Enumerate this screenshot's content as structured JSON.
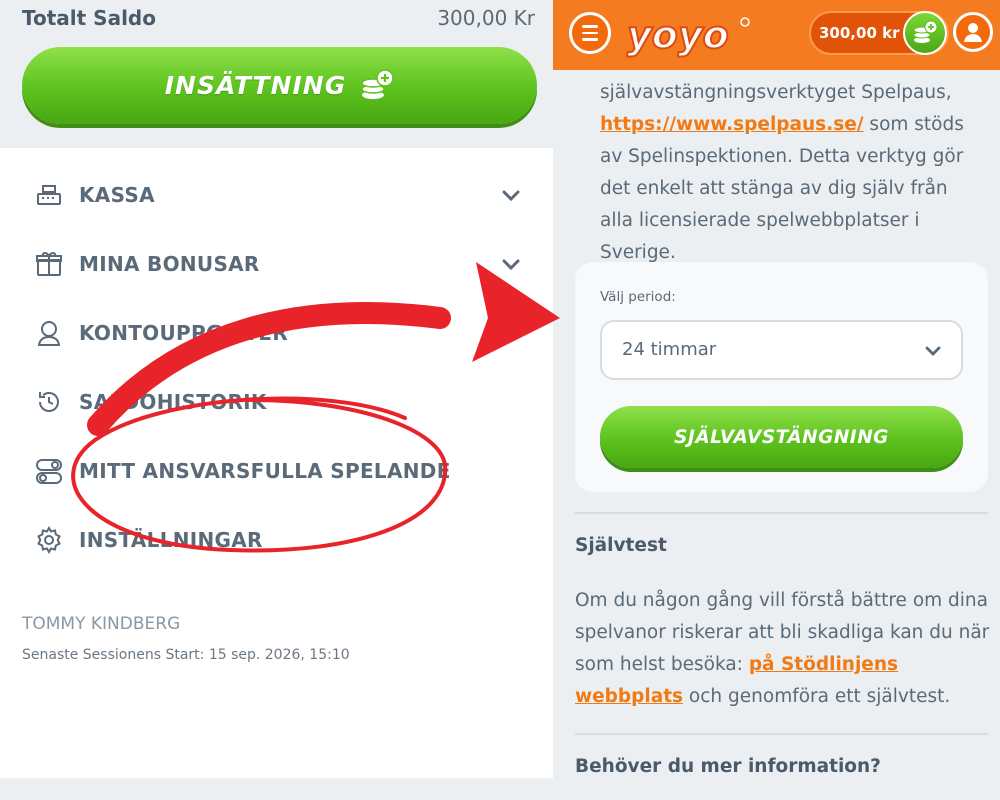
{
  "left": {
    "saldo_label": "Totalt Saldo",
    "saldo_value": "300,00 Kr",
    "deposit_label": "INSÄTTNING",
    "menu": [
      {
        "label": "KASSA",
        "icon": "cash-register-icon",
        "chevron": true
      },
      {
        "label": "MINA BONUSAR",
        "icon": "gift-icon",
        "chevron": true
      },
      {
        "label": "KONTOUPPGIFTER",
        "icon": "user-profile-icon",
        "chevron": true
      },
      {
        "label": "SALDOHISTORIK",
        "icon": "history-icon",
        "chevron": false
      },
      {
        "label": "MITT ANSVARSFULLA SPELANDE",
        "icon": "toggle-icon",
        "chevron": false
      },
      {
        "label": "INSTÄLLNINGAR",
        "icon": "gear-icon",
        "chevron": false
      }
    ],
    "user_name": "TOMMY KINDBERG",
    "session_text": "Senaste Sessionens Start: 15 sep. 2026, 15:10"
  },
  "right": {
    "logo_text": "yoyo",
    "balance": "300,00 kr",
    "intro_text_before": "självavstängningsverktyget Spelpaus,",
    "intro_link": "https://www.spelpaus.se/",
    "intro_text_after": " som stöds av Spelinspektionen. Detta verktyg gör det enkelt att stänga av dig själv från alla licensierade spelwebbplatser i Sverige.",
    "period_label": "Välj period:",
    "period_value": "24 timmar",
    "self_exclusion_label": "SJÄLVAVSTÄNGNING",
    "selftest_heading": "Självtest",
    "selftest_text_before": "Om du någon gång vill förstå bättre om dina spelvanor riskerar att bli skadliga kan du när som helst besöka: ",
    "selftest_link": "på Stödlinjens webbplats",
    "selftest_text_after": " och genomföra ett självtest.",
    "more_info_heading": "Behöver du mer information?"
  },
  "colors": {
    "accent_orange": "#f47b20",
    "button_green": "#5cc21d",
    "annotation_red": "#e8232a",
    "link_orange": "#f27a14"
  }
}
